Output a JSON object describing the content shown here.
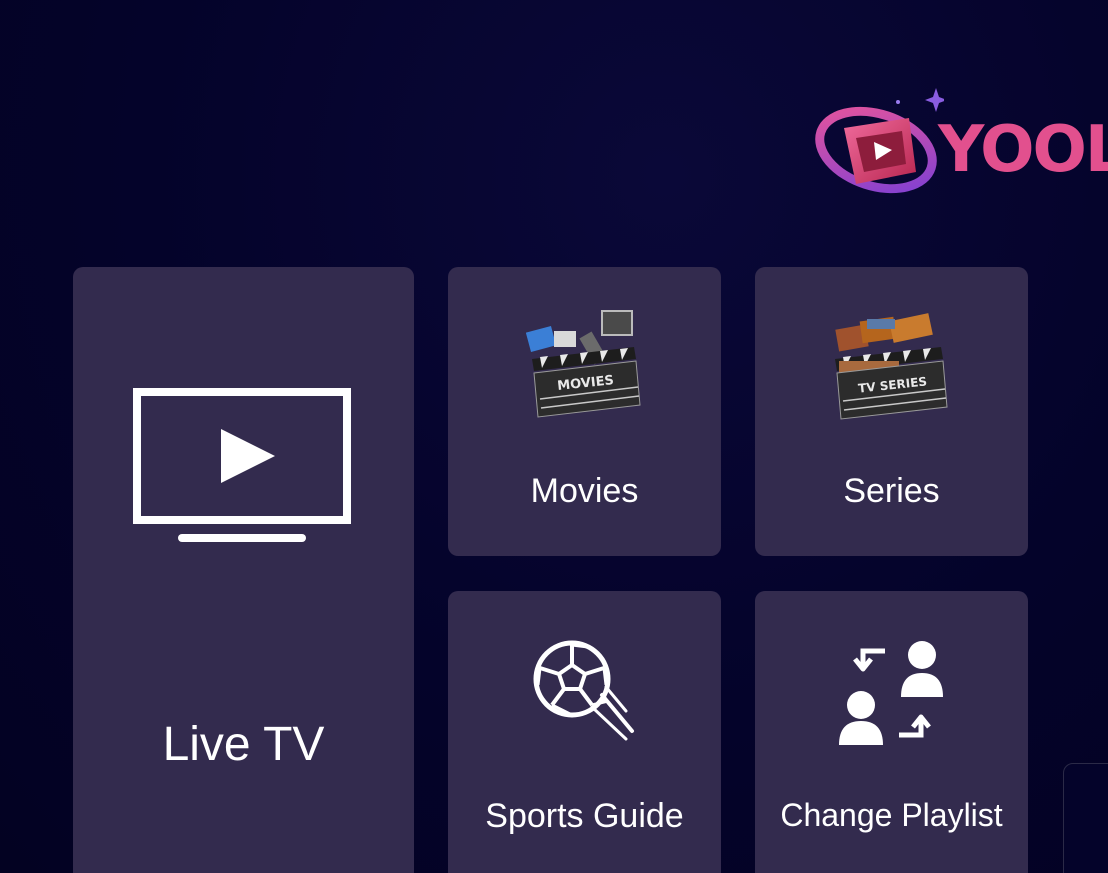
{
  "app": {
    "brand_name": "YOOL"
  },
  "menu": {
    "live_tv": {
      "label": "Live TV",
      "icon": "tv-play-icon"
    },
    "movies": {
      "label": "Movies",
      "icon": "movies-clapperboard-icon",
      "icon_text": "MOVIES"
    },
    "series": {
      "label": "Series",
      "icon": "tv-series-clapperboard-icon",
      "icon_text": "TV SERIES"
    },
    "sports_guide": {
      "label": "Sports Guide",
      "icon": "soccer-ball-icon"
    },
    "change_playlist": {
      "label": "Change Playlist",
      "icon": "switch-users-icon"
    }
  },
  "colors": {
    "background": "#04032a",
    "tile": "#332b4e",
    "brand_pink": "#e2508e",
    "brand_purple": "#7b4ee0"
  }
}
